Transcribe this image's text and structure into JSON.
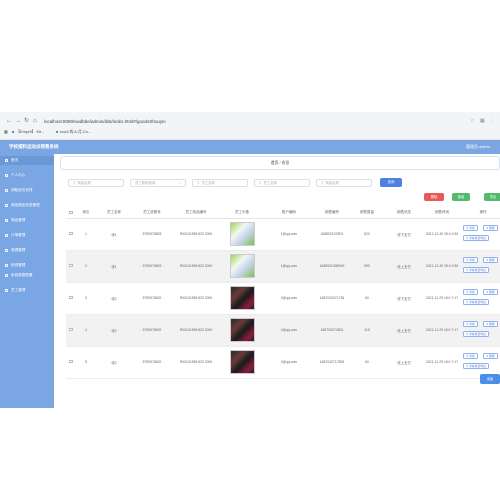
{
  "browser": {
    "address": "localhost:8080/swdbbe/admin/dist/index.html#/goodsShouyin",
    "bookmarks": [
      "【Emyx9】 Mt...",
      "kuo3.的.A.月.Co..."
    ]
  },
  "app": {
    "title": "学校摆料运动派销售系统",
    "admin_label": "管理员 admin"
  },
  "sidebar": {
    "items": [
      {
        "label": "首页"
      },
      {
        "label": "个人中心"
      },
      {
        "label": "领取班次安排"
      },
      {
        "label": "商品借还信息管理"
      },
      {
        "label": "商品管理"
      },
      {
        "label": "订单管理"
      },
      {
        "label": "收银管理"
      },
      {
        "label": "系统管理"
      },
      {
        "label": "系统参数配置"
      },
      {
        "label": "员工管理"
      }
    ]
  },
  "breadcrumb": {
    "home": "首页",
    "sep": "/",
    "current": "收银"
  },
  "filters": [
    {
      "placeholder": "商品名称"
    },
    {
      "placeholder": "员工职称选择"
    },
    {
      "placeholder": "员工名称"
    },
    {
      "placeholder": "员工名称"
    },
    {
      "placeholder": "商品名称"
    }
  ],
  "buttons": {
    "search": "查询",
    "delete": "删除",
    "add": "新增",
    "export": "导出"
  },
  "table": {
    "headers": [
      "索引",
      "员工名称",
      "员工收账号",
      "员工商品编号",
      "员工头像",
      "账户编码",
      "销售编号",
      "销售数量",
      "销售状态",
      "销售时间",
      "操作"
    ],
    "rows": [
      {
        "idx": "1",
        "name": "张1",
        "acct": "5790578893",
        "code": "R00241598 823 2000",
        "img": "green",
        "email": "1@qq.com",
        "sn": "1688921378R1",
        "qty": "820",
        "status": "线下支付",
        "time": "2021-12-30 09:4 0:36"
      },
      {
        "idx": "2",
        "name": "张1",
        "acct": "5790578893",
        "code": "R00241598 823 2000",
        "img": "green",
        "email": "1@qq.com",
        "sn": "1688921398S49",
        "qty": "999",
        "status": "线上支付",
        "time": "2021-12-30 09:4 0:36"
      },
      {
        "idx": "3",
        "name": "张2",
        "acct": "5790578692",
        "code": "R00241598 823 2000",
        "img": "dark",
        "email": "2@qq.com",
        "sn": "1687032571736",
        "qty": "60",
        "status": "线下支付",
        "time": "2021-11-29 16:0 7:17"
      },
      {
        "idx": "4",
        "name": "张2",
        "acct": "5790578692",
        "code": "R00241598 823 2000",
        "img": "dark",
        "email": "2@qq.com",
        "sn": "1687032706B1",
        "qty": "115",
        "status": "线上支付",
        "time": "2021-11-29 16:0 7:17"
      },
      {
        "idx": "5",
        "name": "张2",
        "acct": "5790578692",
        "code": "R00241598 823 2000",
        "img": "dark",
        "email": "2@qq.com",
        "sn": "1687032717809",
        "qty": "60",
        "status": "线上支付",
        "time": "2021-11-29 16:0 7:17"
      }
    ],
    "row_ops": {
      "detail": "详情",
      "delete": "删除",
      "address": "查看收货地址"
    }
  },
  "float_badge": "客服"
}
